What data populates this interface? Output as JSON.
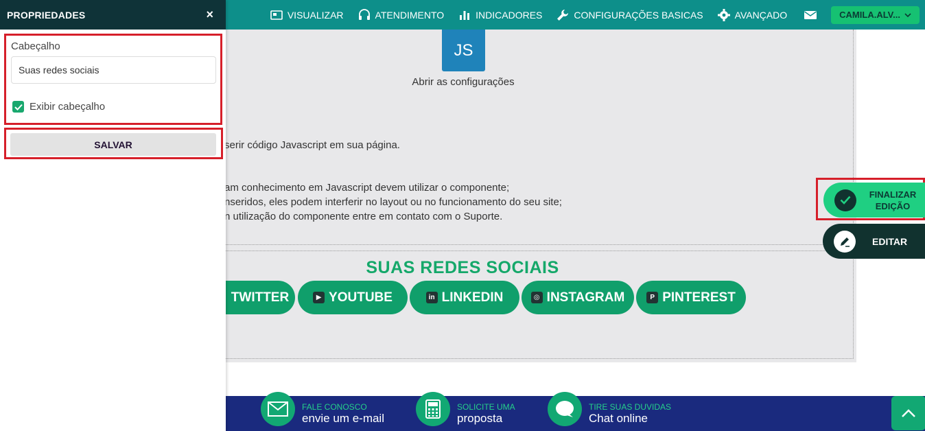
{
  "colors": {
    "topbar": "#0d8f8a",
    "panel_header": "#0f3338",
    "accent_green": "#16c172",
    "social_green": "#109f6b",
    "footer": "#1a2a7e",
    "highlight_red": "#d61f2a"
  },
  "topnav": {
    "visualizar": "VISUALIZAR",
    "atendimento": "ATENDIMENTO",
    "indicadores": "INDICADORES",
    "config_basicas": "CONFIGURAÇÕES BASICAS",
    "avancado": "AVANÇADO",
    "user": "CAMILA.ALV..."
  },
  "panel": {
    "title": "PROPRIEDADES",
    "close": "×",
    "header_label": "Cabeçalho",
    "header_value": "Suas redes sociais",
    "show_header_label": "Exibir cabeçalho",
    "save": "SALVAR"
  },
  "js_component": {
    "badge": "JS",
    "caption": "Abrir as configurações",
    "line1": "serir código Javascript em sua página.",
    "line2": "am conhecimento em Javascript devem utilizar o componente;",
    "line3": "nseridos, eles podem interferir no layout ou no funcionamento do seu site;",
    "line4": "n utilização do componente entre em contato com o Suporte."
  },
  "social": {
    "title": "SUAS REDES SOCIAIS",
    "buttons": [
      "TWITTER",
      "YOUTUBE",
      "LINKEDIN",
      "INSTAGRAM",
      "PINTEREST"
    ]
  },
  "floating": {
    "finish_line1": "FINALIZAR",
    "finish_line2": "EDIÇÃO",
    "edit": "EDITAR"
  },
  "footer": {
    "contact_small": "FALE CONOSCO",
    "contact_big": "envie um e-mail",
    "quote_small": "SOLICITE UMA",
    "quote_big": "proposta",
    "chat_small": "TIRE SUAS DUVIDAS",
    "chat_big": "Chat online"
  }
}
